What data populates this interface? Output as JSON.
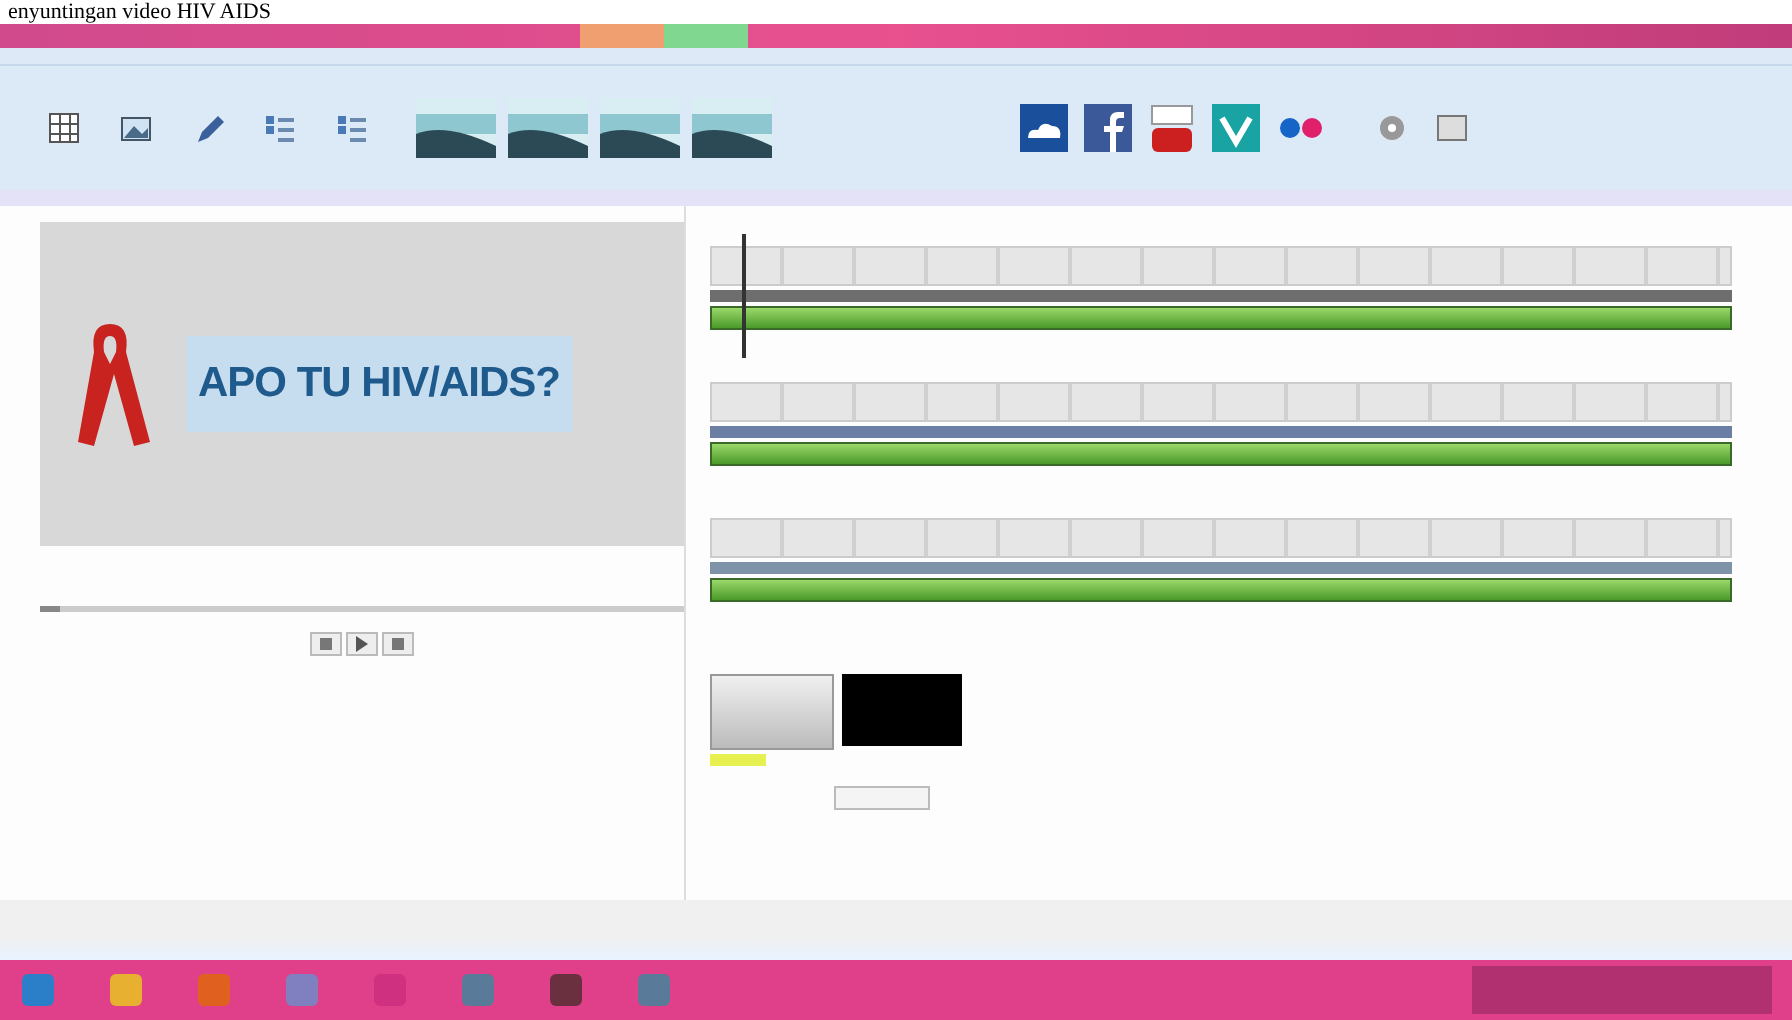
{
  "caption": "enyuntingan video HIV AIDS",
  "ribbon": {
    "tools": [
      {
        "kind": "grid"
      },
      {
        "kind": "image"
      },
      {
        "kind": "pen"
      },
      {
        "kind": "list"
      },
      {
        "kind": "list"
      }
    ],
    "themes": [
      {
        "kind": "theme"
      },
      {
        "kind": "theme"
      },
      {
        "kind": "theme"
      },
      {
        "kind": "theme"
      }
    ],
    "share": [
      {
        "kind": "cloud"
      },
      {
        "kind": "facebook"
      },
      {
        "kind": "youtube"
      },
      {
        "kind": "vimeo"
      },
      {
        "kind": "flickr"
      }
    ]
  },
  "preview": {
    "title_text": "APO TU HIV/AIDS?",
    "seek": {
      "level": 0.03
    }
  },
  "storyboard": {
    "rows": [
      {
        "color": "#6e6e6e",
        "playhead": true
      },
      {
        "color": "#6a7fa3",
        "playhead": false
      },
      {
        "color": "#7f93a8",
        "playhead": false
      }
    ],
    "end_clips": [
      {
        "kind": "title-card"
      },
      {
        "kind": "black"
      }
    ]
  },
  "taskbar": [
    {
      "kind": "start"
    },
    {
      "kind": "folder"
    },
    {
      "kind": "browser"
    },
    {
      "kind": "media"
    },
    {
      "kind": "player"
    },
    {
      "kind": "app"
    },
    {
      "kind": "film"
    },
    {
      "kind": "app"
    }
  ]
}
